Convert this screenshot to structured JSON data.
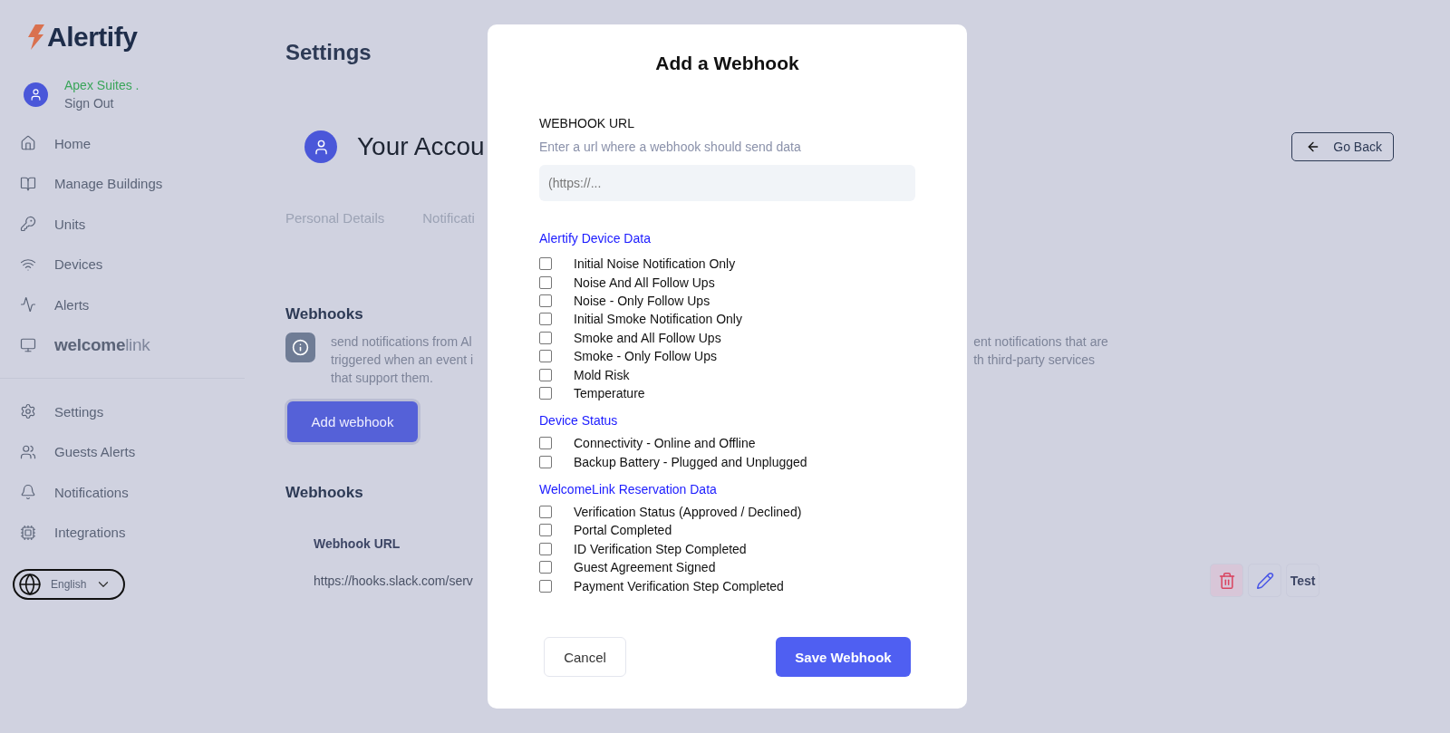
{
  "sidebar": {
    "logo": "Alertify",
    "user": {
      "name": "Apex Suites .",
      "action": "Sign Out"
    },
    "items": [
      {
        "kind": "link",
        "label": "Home"
      },
      {
        "kind": "link",
        "label": "Manage Buildings"
      },
      {
        "kind": "link",
        "label": "Units"
      },
      {
        "kind": "link",
        "label": "Devices"
      },
      {
        "kind": "link",
        "label": "Alerts"
      },
      {
        "kind": "logo",
        "label": "welcome",
        "label_light": "link"
      }
    ],
    "bottom_items": [
      {
        "kind": "link",
        "label": "Settings"
      },
      {
        "kind": "link",
        "label": "Guests Alerts"
      },
      {
        "kind": "link",
        "label": "Notifications"
      },
      {
        "kind": "link",
        "label": "Integrations"
      }
    ],
    "language": "English"
  },
  "page": {
    "title": "Settings",
    "account_title": "Your Accou",
    "go_back": "Go Back",
    "tabs": [
      {
        "label": "Personal Details",
        "selected": false
      },
      {
        "label": "Notificati",
        "selected": false
      }
    ],
    "webhooks": {
      "title": "Webhooks",
      "description_left": [
        "send notifications from Al",
        "triggered when an event i",
        "that support them."
      ],
      "description_right": [
        "ent notifications that are",
        "th third-party services"
      ],
      "add_button": "Add webhook"
    },
    "list": {
      "title": "Webhooks",
      "columns": [
        "Webhook URL"
      ],
      "rows": [
        {
          "url": "https://hooks.slack.com/serv",
          "test": "Test"
        }
      ]
    }
  },
  "modal": {
    "title": "Add a Webhook",
    "url_label": "WEBHOOK URL",
    "url_hint": "Enter a url where a webhook should send data",
    "url_placeholder": "(https://...",
    "groups": [
      {
        "title": "Alertify Device Data",
        "options": [
          {
            "label": "Initial Noise Notification Only",
            "checked": false
          },
          {
            "label": "Noise And All Follow Ups",
            "checked": false
          },
          {
            "label": "Noise - Only Follow Ups",
            "checked": false
          },
          {
            "label": "Initial Smoke Notification Only",
            "checked": false
          },
          {
            "label": "Smoke and All Follow Ups",
            "checked": false
          },
          {
            "label": "Smoke - Only Follow Ups",
            "checked": false
          },
          {
            "label": "Mold Risk",
            "checked": false
          },
          {
            "label": "Temperature",
            "checked": false
          }
        ]
      },
      {
        "title": "Device Status",
        "options": [
          {
            "label": "Connectivity - Online and Offline",
            "checked": false
          },
          {
            "label": "Backup Battery - Plugged and Unplugged",
            "checked": false
          }
        ]
      },
      {
        "title": "WelcomeLink Reservation Data",
        "options": [
          {
            "label": "Verification Status (Approved / Declined)",
            "checked": false
          },
          {
            "label": "Portal Completed",
            "checked": false
          },
          {
            "label": "ID Verification Step Completed",
            "checked": false
          },
          {
            "label": "Guest Agreement Signed",
            "checked": false
          },
          {
            "label": "Payment Verification Step Completed",
            "checked": false
          }
        ]
      }
    ],
    "cancel": "Cancel",
    "save": "Save Webhook"
  }
}
